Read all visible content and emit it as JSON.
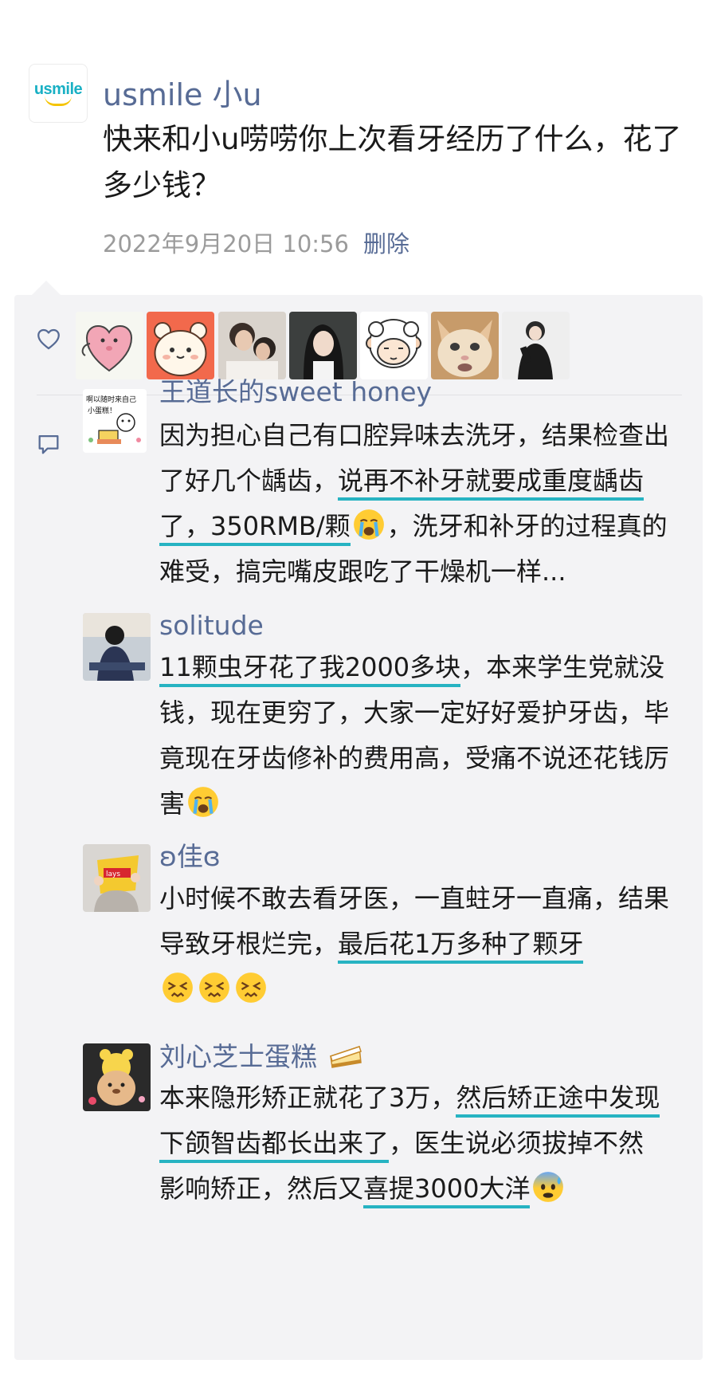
{
  "post": {
    "logo_text": "usmile",
    "author": "usmile 小u",
    "text": "快来和小u唠唠你上次看牙经历了什么，花了多少钱？",
    "date": "2022年9月20日 10:56",
    "delete_label": "删除"
  },
  "likes": {
    "icon": "heart-icon",
    "avatar_count": 7
  },
  "comments": [
    {
      "name": "王道长的sweet honey",
      "avatar_caption": "啊以随时来自己 小蛋糕！",
      "parts": [
        "因为担心自己有口腔异味去洗牙，结果检查出了好几个龋齿，",
        "说再不补牙就要成重度龋齿了，350RMB/颗",
        "，洗牙和补牙的过程真的难受，搞完嘴皮跟吃了干燥机一样..."
      ]
    },
    {
      "name": "solitude",
      "parts": [
        "11颗虫牙花了我2000多块",
        "，本来学生党就没钱，现在更穷了，大家一定好好爱护牙齿，毕竟现在牙齿修补的费用高，受痛不说还花钱厉害"
      ]
    },
    {
      "name": "ʚ佳ɞ",
      "parts": [
        "小时候不敢去看牙医，一直蛀牙一直痛，结果导致牙根烂完，",
        "最后花1万多种了颗牙"
      ]
    },
    {
      "name": "刘心芝士蛋糕",
      "parts": [
        "本来隐形矫正就花了3万，",
        "然后矫正途中发现下颌智齿都长出来了",
        "，医生说必须拔掉不然影响矫正，然后又",
        "喜提3000大洋"
      ]
    }
  ],
  "colors": {
    "link": "#576b95",
    "highlight_underline": "#27b3c2",
    "panel_bg": "#f3f3f5"
  }
}
